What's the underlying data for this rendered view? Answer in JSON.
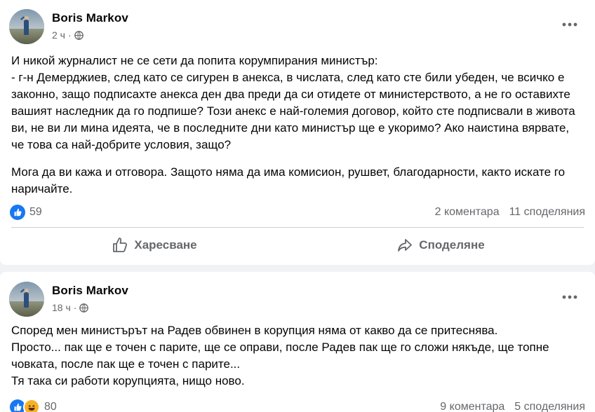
{
  "posts": [
    {
      "author": "Boris Markov",
      "time": "2 ч",
      "paragraphs": [
        "И никой журналист не се сети да попита корумпирания министър:\n- г-н Демерджиев, след като се сигурен в анекса, в числата, след като сте били убеден, че всичко е законно, защо подписахте анекса ден два преди да си отидете от министерството, а не го оставихте вашият наследник да го подпише? Този анекс е най-големия договор, който сте подписвали в живота ви, не ви ли мина идеята, че в последните дни като министър ще е укоримо? Ако наистина вярвате, че това са най-добрите условия, защо?",
        "Мога да ви кажа и отговора. Защото няма да има комисион, рушвет, благодарности, както искате го наричайте."
      ],
      "reactions": [
        "like"
      ],
      "reaction_count": "59",
      "comments": "2 коментара",
      "shares": "11 споделяния",
      "actions": {
        "like": "Харесване",
        "share": "Споделяне"
      }
    },
    {
      "author": "Boris Markov",
      "time": "18 ч",
      "paragraphs": [
        "Според мен министърът на Радев обвинен в корупция няма от какво да се притеснява.\nПросто... пак ще е точен с парите, ще се оправи, после Радев пак ще го сложи някъде, ще топне човката, после пак ще е точен с парите...\nТя така си работи корупцията, нищо ново."
      ],
      "reactions": [
        "like",
        "haha"
      ],
      "reaction_count": "80",
      "comments": "9 коментара",
      "shares": "5 споделяния"
    }
  ],
  "colors": {
    "background": "#f0f2f5",
    "card": "#ffffff",
    "text": "#050505",
    "secondary_text": "#65676b",
    "like_blue": "#1877f2",
    "haha_yellow": "#f7b125"
  }
}
